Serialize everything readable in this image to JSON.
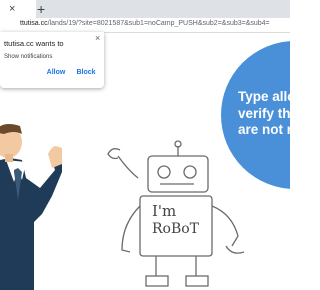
{
  "browser": {
    "tab_title": "",
    "new_tab": "+",
    "close_glyph": "×",
    "url_host": "ttutisa.cc",
    "url_path": "/lands/19/?site=8021587&sub1=noCamp_PUSH&sub2=&sub3=&sub4="
  },
  "permission_popup": {
    "title": "ttutisa.cc wants to",
    "body": "Show notifications",
    "allow_label": "Allow",
    "block_label": "Block",
    "close_glyph": "×"
  },
  "main": {
    "bubble_text": "Type allo\nverify th\nare not r",
    "robot_sign_line1": "I'm",
    "robot_sign_line2": "RoBoT"
  },
  "colors": {
    "accent": "#1a73e8",
    "bubble": "#4a90d9"
  }
}
